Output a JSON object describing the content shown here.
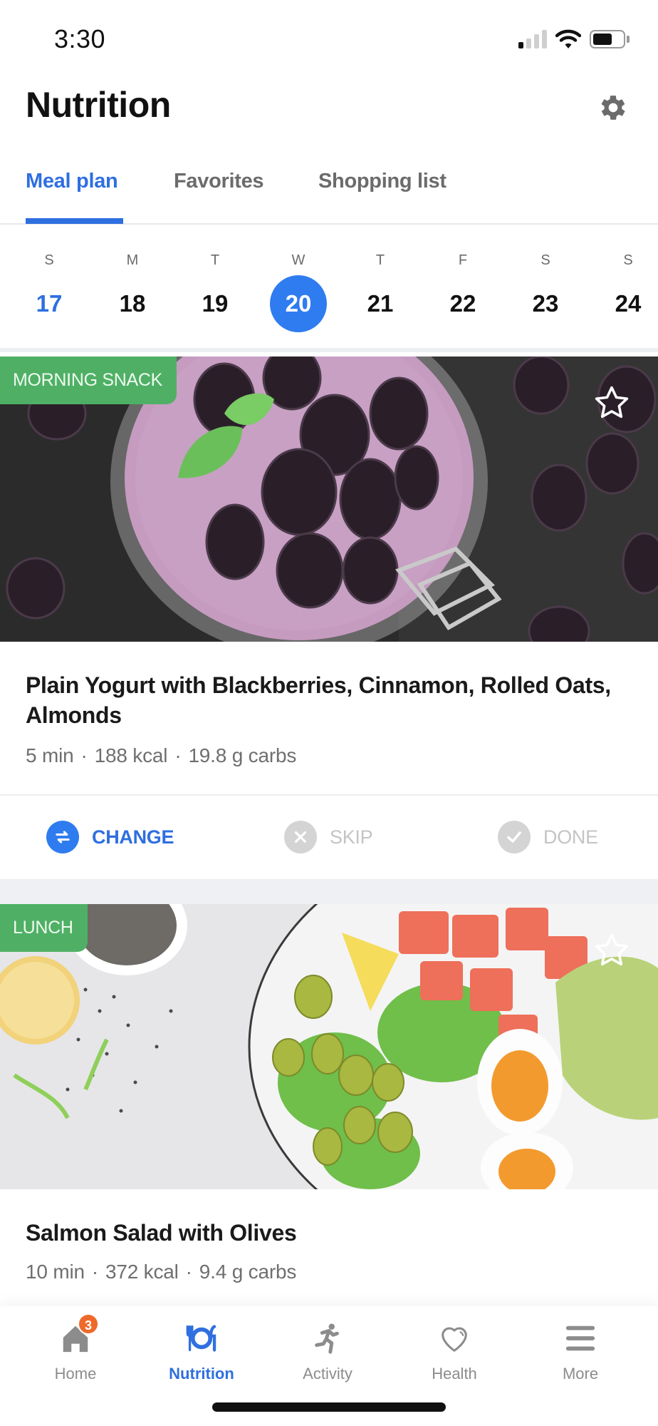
{
  "status_bar": {
    "time": "3:30",
    "signal_bars_active": 1,
    "signal_bars_total": 4,
    "wifi_icon": "wifi-icon",
    "battery_level": 0.65
  },
  "header": {
    "title": "Nutrition",
    "settings_icon": "gear-icon"
  },
  "tabs": [
    {
      "label": "Meal plan",
      "active": true
    },
    {
      "label": "Favorites",
      "active": false
    },
    {
      "label": "Shopping list",
      "active": false
    }
  ],
  "calendar": {
    "days": [
      {
        "dow": "S",
        "num": "17",
        "today": true,
        "selected": false
      },
      {
        "dow": "M",
        "num": "18",
        "today": false,
        "selected": false
      },
      {
        "dow": "T",
        "num": "19",
        "today": false,
        "selected": false
      },
      {
        "dow": "W",
        "num": "20",
        "today": false,
        "selected": true
      },
      {
        "dow": "T",
        "num": "21",
        "today": false,
        "selected": false
      },
      {
        "dow": "F",
        "num": "22",
        "today": false,
        "selected": false
      },
      {
        "dow": "S",
        "num": "23",
        "today": false,
        "selected": false
      },
      {
        "dow": "S",
        "num": "24",
        "today": false,
        "selected": false
      }
    ]
  },
  "meals": [
    {
      "badge": "MORNING SNACK",
      "image": "yogurt-with-blackberries-photo",
      "favorite": false,
      "title": "Plain Yogurt with Blackberries, Cinnamon, Rolled Oats, Almonds",
      "time": "5 min",
      "kcal": "188 kcal",
      "carbs": "19.8 g carbs",
      "separator": "·",
      "actions": [
        {
          "label": "CHANGE",
          "icon": "swap-arrows-icon",
          "state": "primary"
        },
        {
          "label": "SKIP",
          "icon": "close-circle-icon",
          "state": "disabled"
        },
        {
          "label": "DONE",
          "icon": "check-circle-icon",
          "state": "disabled"
        }
      ]
    },
    {
      "badge": "LUNCH",
      "image": "salmon-salad-photo",
      "favorite": false,
      "title": "Salmon Salad with Olives",
      "time": "10 min",
      "kcal": "372 kcal",
      "carbs": "9.4 g carbs",
      "separator": "·"
    }
  ],
  "bottom_nav": [
    {
      "label": "Home",
      "icon": "home-icon",
      "badge": "3",
      "active": false
    },
    {
      "label": "Nutrition",
      "icon": "plate-cutlery-icon",
      "active": true
    },
    {
      "label": "Activity",
      "icon": "running-icon",
      "active": false
    },
    {
      "label": "Health",
      "icon": "heart-icon",
      "active": false
    },
    {
      "label": "More",
      "icon": "menu-icon",
      "active": false
    }
  ],
  "colors": {
    "accent": "#2f6fe0",
    "badge_green": "#4fb065",
    "notification": "#ee6a2a",
    "muted_text": "#6f6f6f",
    "disabled": "#c4c4c4"
  }
}
